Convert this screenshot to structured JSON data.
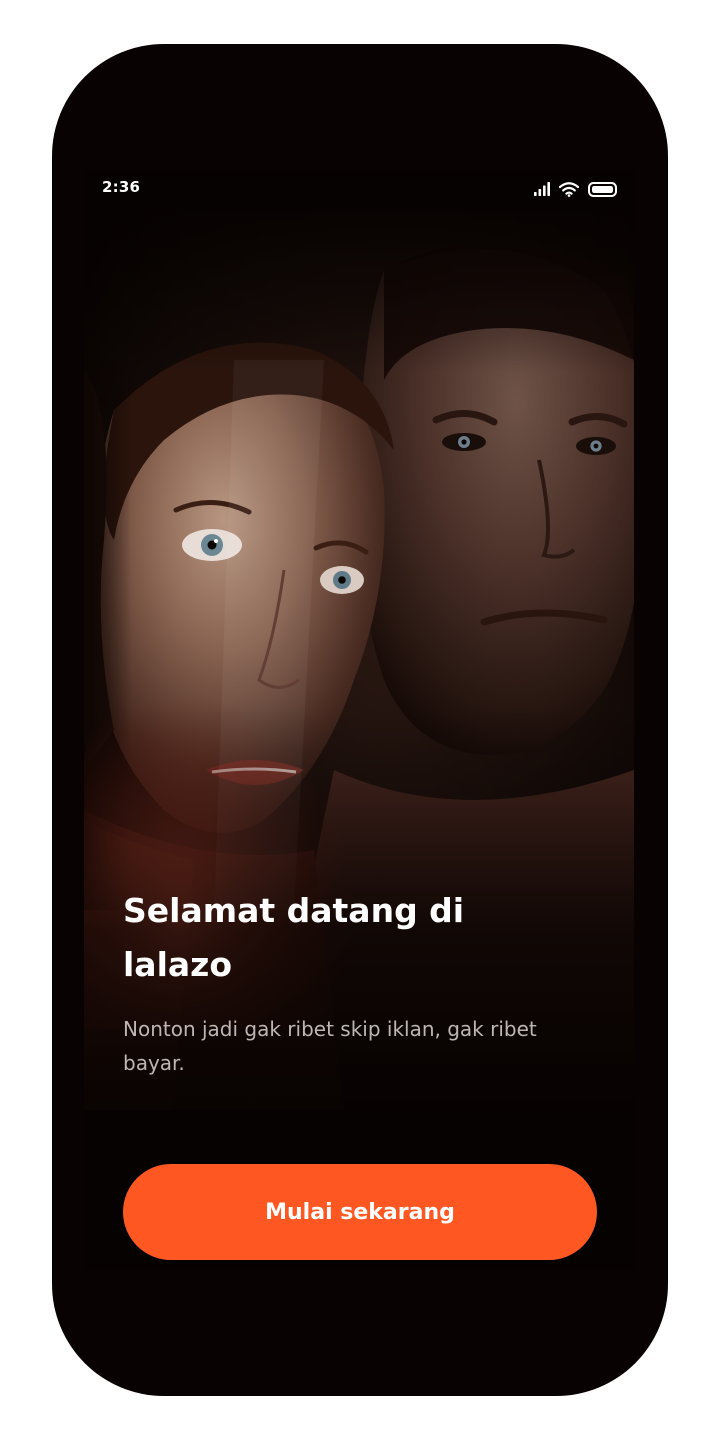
{
  "status_bar": {
    "time": "2:36",
    "icons": [
      "signal-icon",
      "wifi-icon",
      "battery-icon"
    ]
  },
  "hero": {
    "image": "movie-poster-two-faces"
  },
  "welcome": {
    "title": "Selamat datang di lalazo",
    "subtitle": "Nonton jadi gak ribet skip iklan, gak ribet bayar."
  },
  "cta": {
    "label": "Mulai sekarang"
  },
  "colors": {
    "accent": "#ff5722",
    "background": "#060201",
    "title_text": "#ffffff",
    "subtitle_text": "#bdb6b3"
  }
}
